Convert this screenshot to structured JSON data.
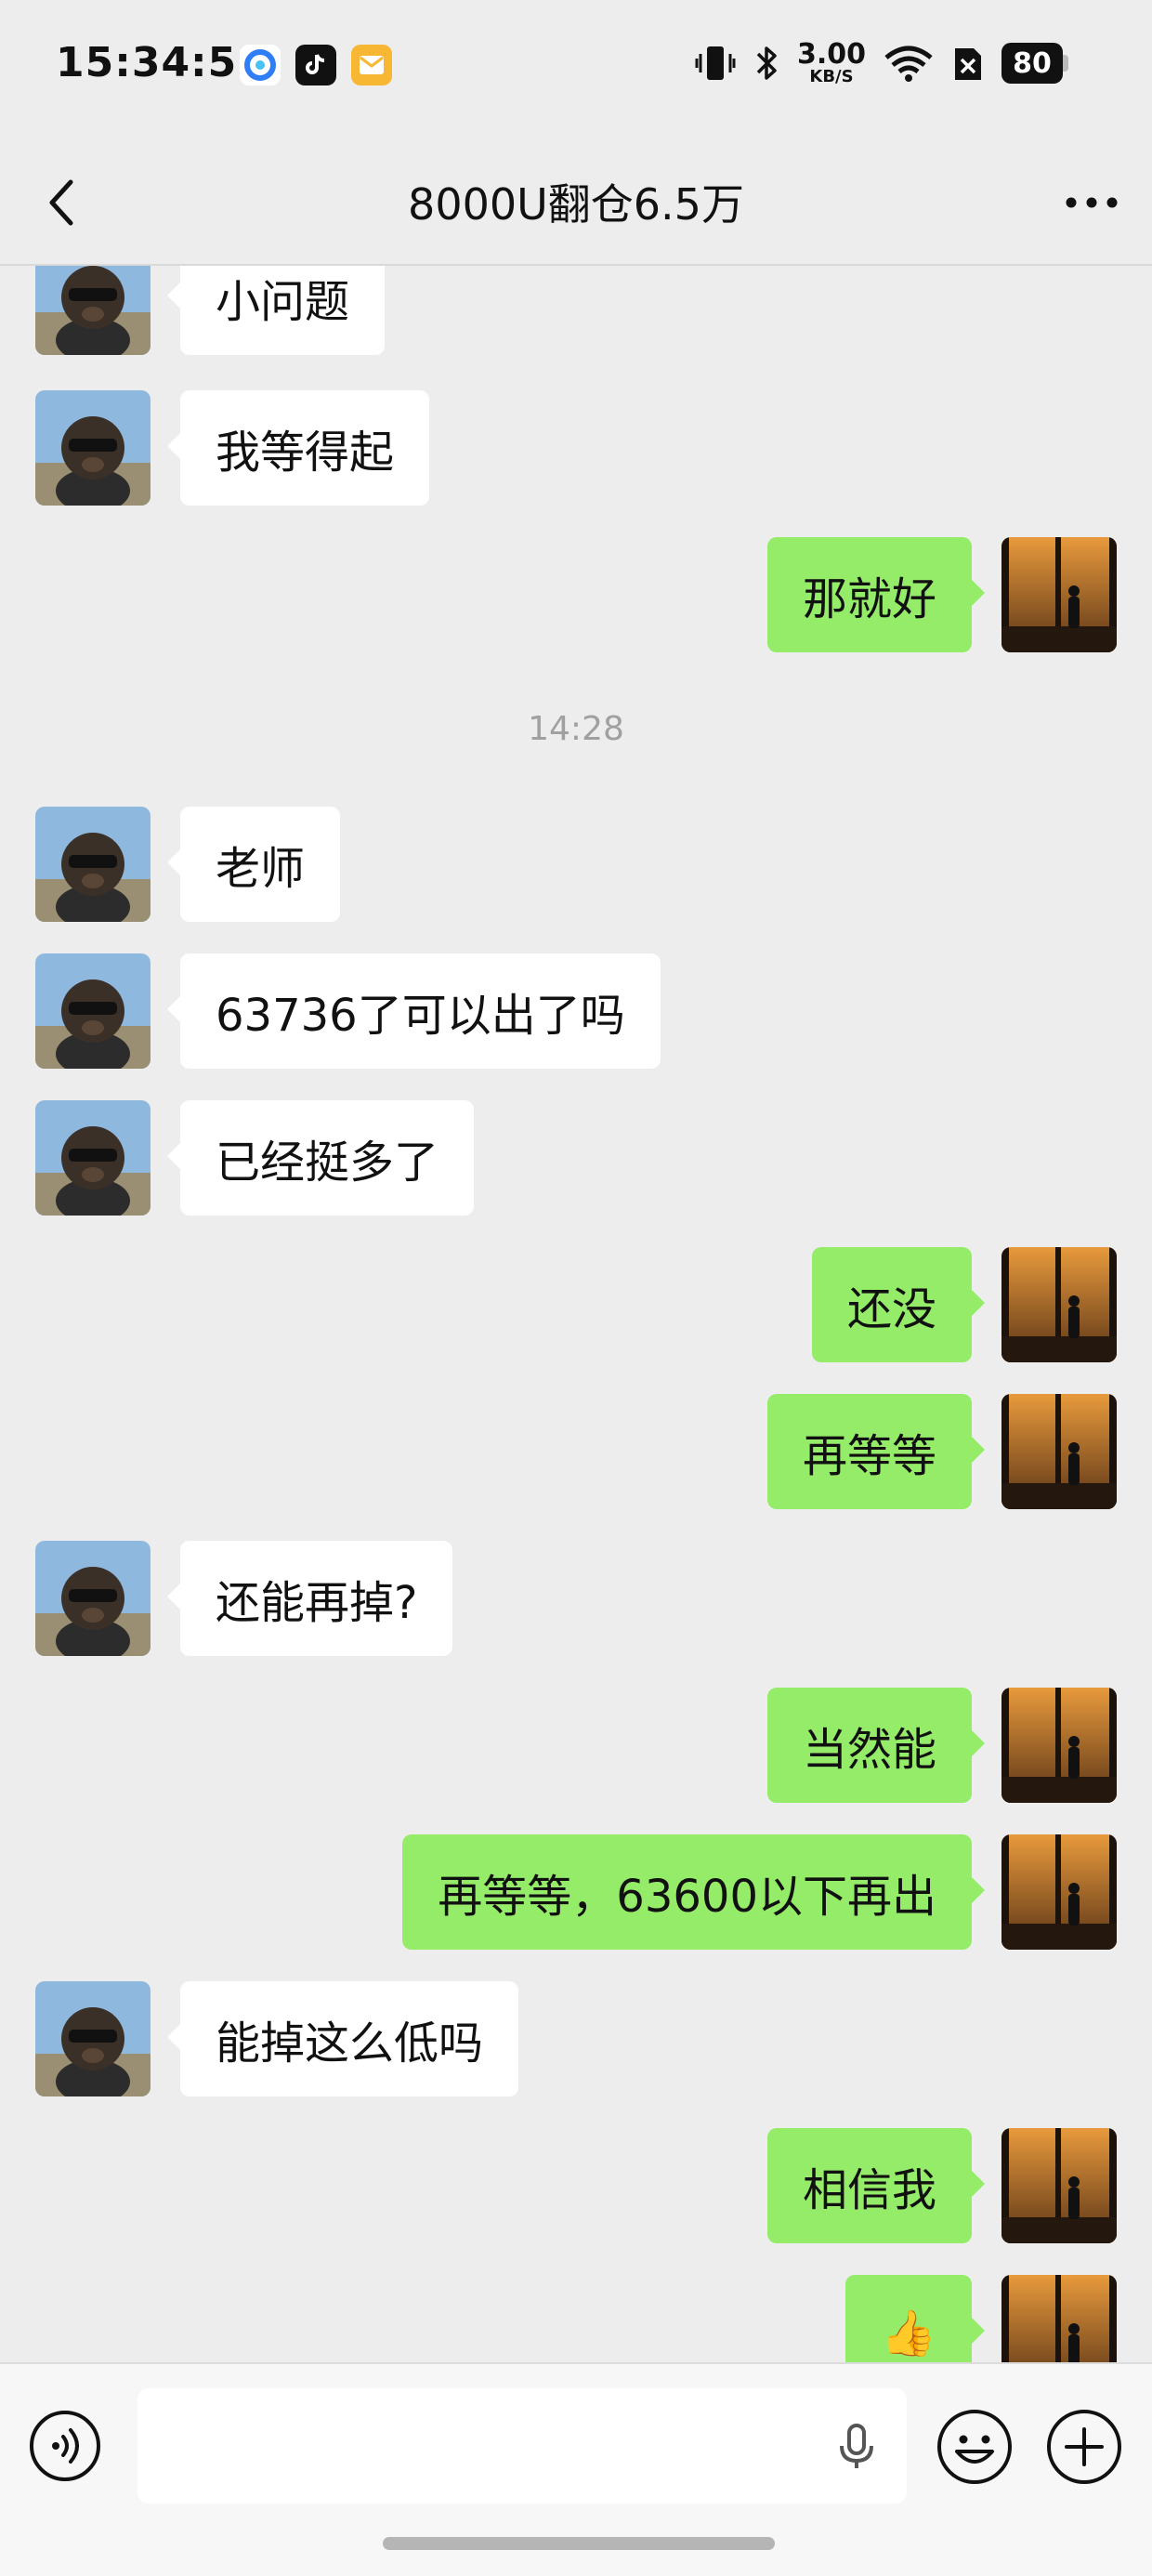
{
  "status_bar": {
    "time": "15:34:51",
    "net_speed_value": "3.00",
    "net_speed_unit": "KB/S",
    "battery": "80"
  },
  "nav": {
    "title": "8000U翻仓6.5万",
    "back_icon": "chevron-left-icon",
    "more_icon": "more-dots-icon"
  },
  "colors": {
    "background": "#ededed",
    "incoming_bubble": "#ffffff",
    "outgoing_bubble": "#95ec69",
    "timestamp_text": "#a0a0a0"
  },
  "messages": [
    {
      "side": "left",
      "text": "小问题"
    },
    {
      "side": "left",
      "text": "我等得起"
    },
    {
      "side": "right",
      "text": "那就好"
    },
    {
      "type": "timestamp",
      "text": "14:28"
    },
    {
      "side": "left",
      "text": "老师"
    },
    {
      "side": "left",
      "text": "63736了可以出了吗"
    },
    {
      "side": "left",
      "text": "已经挺多了"
    },
    {
      "side": "right",
      "text": "还没"
    },
    {
      "side": "right",
      "text": "再等等"
    },
    {
      "side": "left",
      "text": "还能再掉?"
    },
    {
      "side": "right",
      "text": "当然能"
    },
    {
      "side": "right",
      "text": "再等等，63600以下再出"
    },
    {
      "side": "left",
      "text": "能掉这么低吗"
    },
    {
      "side": "right",
      "text": "相信我"
    },
    {
      "side": "right",
      "text": "👍"
    }
  ],
  "input_bar": {
    "voice_icon": "voice-mode-icon",
    "mic_icon": "microphone-icon",
    "emoji_icon": "emoji-icon",
    "plus_icon": "plus-icon"
  }
}
